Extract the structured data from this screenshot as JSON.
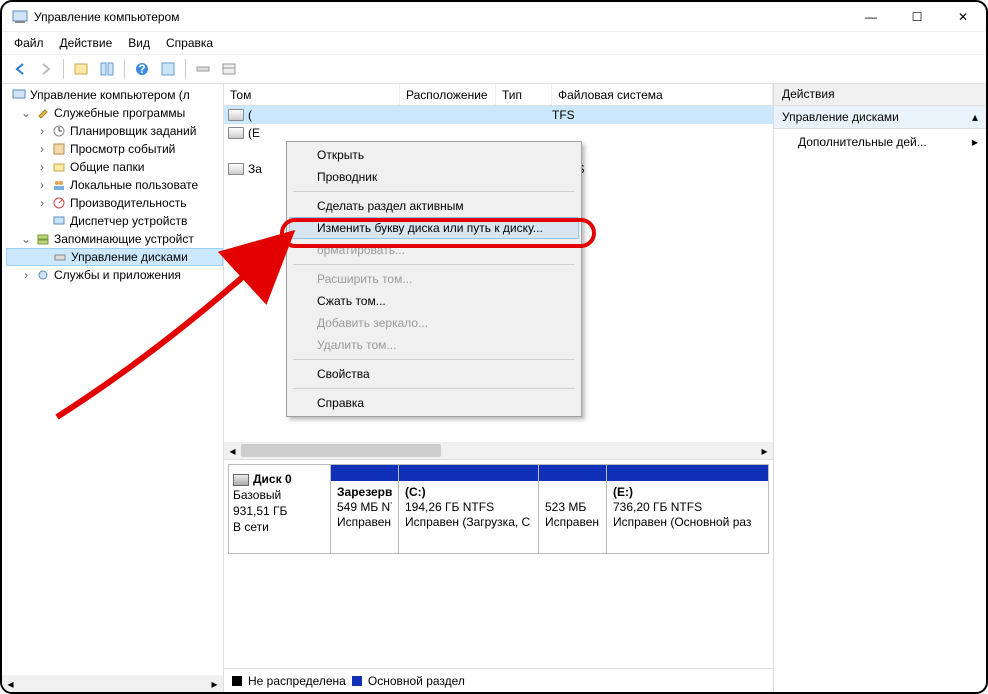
{
  "window": {
    "title": "Управление компьютером",
    "min": "—",
    "max": "☐",
    "close": "✕"
  },
  "menu": {
    "file": "Файл",
    "action": "Действие",
    "view": "Вид",
    "help": "Справка"
  },
  "tree": {
    "root": "Управление компьютером (л",
    "sys_tools": "Служебные программы",
    "task_sched": "Планировщик заданий",
    "event_viewer": "Просмотр событий",
    "shared": "Общие папки",
    "local_users": "Локальные пользовате",
    "perf": "Производительность",
    "devmgr": "Диспетчер устройств",
    "storage": "Запоминающие устройст",
    "diskmgmt": "Управление дисками",
    "services": "Службы и приложения"
  },
  "vol_cols": {
    "volume": "Том",
    "layout": "Расположение",
    "type": "Тип",
    "fs": "Файловая система"
  },
  "vol_rows": {
    "r0_label": "(",
    "r0_fs": "TFS",
    "r1_label": "(E",
    "r2_label": "За",
    "r2_fs": "TFS"
  },
  "ctx": {
    "open": "Открыть",
    "explorer": "Проводник",
    "active": "Сделать раздел активным",
    "change_letter": "Изменить букву диска или путь к диску...",
    "format": "орматировать...",
    "extend": "Расширить том...",
    "shrink": "Сжать том...",
    "mirror": "Добавить зеркало...",
    "delete": "Удалить том...",
    "props": "Свойства",
    "help": "Справка"
  },
  "disk": {
    "name": "Диск 0",
    "type": "Базовый",
    "size": "931,51 ГБ",
    "status": "В сети",
    "p0_name": "Зарезерв",
    "p0_size": "549 МБ NT",
    "p0_status": "Исправен",
    "p1_name": "(C:)",
    "p1_size": "194,26 ГБ NTFS",
    "p1_status": "Исправен (Загрузка, С",
    "p2_size": "523 МБ",
    "p2_status": "Исправен",
    "p3_name": "(E:)",
    "p3_size": "736,20 ГБ NTFS",
    "p3_status": "Исправен (Основной раз"
  },
  "legend": {
    "unalloc": "Не распределена",
    "primary": "Основной раздел"
  },
  "actions": {
    "header": "Действия",
    "diskmgmt": "Управление дисками",
    "more": "Дополнительные дей..."
  }
}
